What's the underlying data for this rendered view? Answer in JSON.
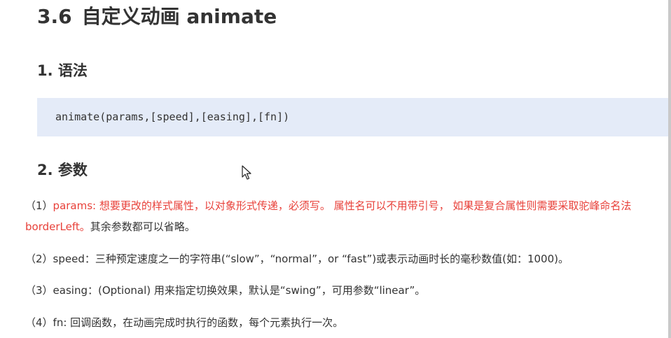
{
  "section": {
    "number": "3.6",
    "title": "自定义动画 animate"
  },
  "syntax": {
    "heading": "1. 语法",
    "code": "animate(params,[speed],[easing],[fn])"
  },
  "params": {
    "heading": "2. 参数",
    "items": [
      {
        "prefix": "（1）",
        "highlight": "params: 想要更改的样式属性，以对象形式传递，必须写。 属性名可以不用带引号， 如果是复合属性则需要采取驼峰命名法 borderLeft。",
        "rest": "其余参数都可以省略。"
      },
      {
        "text": "（2）speed：三种预定速度之一的字符串(“slow”，“normal”，or “fast”)或表示动画时长的毫秒数值(如：1000)。"
      },
      {
        "text": "（3）easing：(Optional) 用来指定切换效果，默认是“swing”，可用参数“linear”。"
      },
      {
        "text": "（4）fn: 回调函数，在动画完成时执行的函数，每个元素执行一次。"
      }
    ]
  },
  "colors": {
    "accent_red": "#e8413a",
    "code_background": "#e4ebf8",
    "text": "#333333"
  },
  "icons": {
    "cursor": "mouse-pointer-icon"
  }
}
